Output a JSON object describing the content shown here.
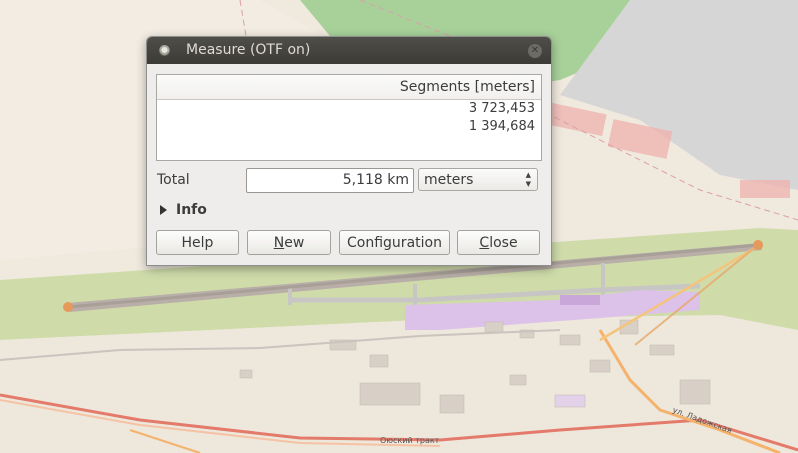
{
  "dialog": {
    "title": "Measure (OTF on)",
    "table": {
      "header": "Segments [meters]",
      "rows": [
        "3 723,453",
        "1 394,684"
      ]
    },
    "total_label": "Total",
    "total_value": "5,118 km",
    "unit_selected": "meters",
    "info_label": "Info",
    "buttons": {
      "help": "Help",
      "new_first": "N",
      "new_rest": "ew",
      "configuration": "Configuration",
      "close_first": "C",
      "close_rest": "lose"
    }
  },
  "map": {
    "labels": [
      "Оюский тракт",
      "ул. Ладожская"
    ],
    "colors": {
      "background": "#efe8dc",
      "green": "#cbdca6",
      "runway": "#b7ada8",
      "terminal": "#d7b8e6",
      "measure_line": "#a8a199",
      "measure_point": "#e5995a",
      "road_orange": "#f4b26b",
      "road_red": "#e37a6a"
    }
  }
}
